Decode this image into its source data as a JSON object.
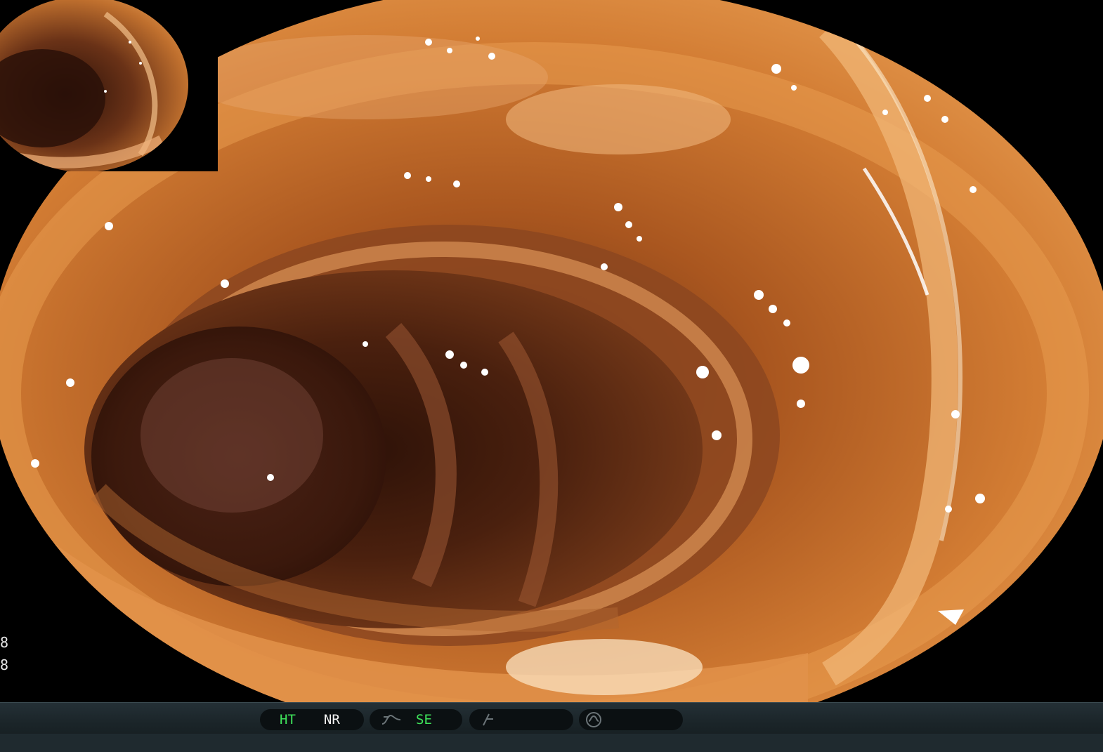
{
  "screen_title": "",
  "side_readout": {
    "line1": "8",
    "line2": "8"
  },
  "status_bar": {
    "group1": {
      "left_label": "HT",
      "right_label": "NR"
    },
    "group2": {
      "icon": "tone-curve-icon",
      "label": "SE"
    },
    "group3": {
      "icon": "filter-icon"
    },
    "group4": {
      "icon": "waveform-circle-icon"
    }
  },
  "colors": {
    "status_active": "#3fe35a",
    "status_text": "#f2f2f2",
    "status_bg": "#1b2529",
    "pill_bg": "#0b1012"
  }
}
